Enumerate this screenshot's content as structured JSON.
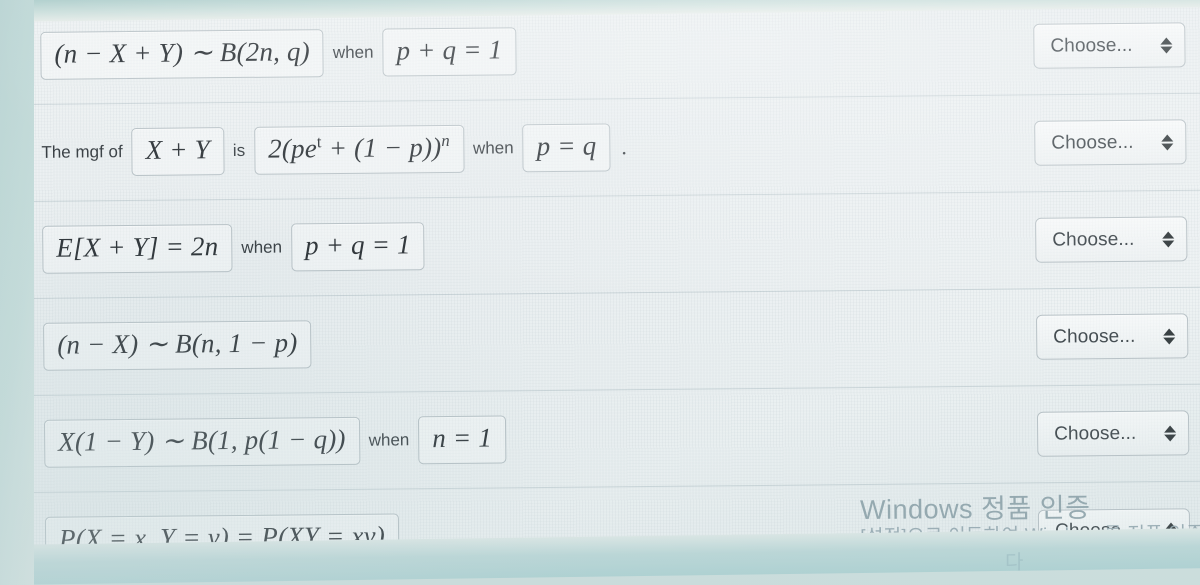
{
  "watermark": {
    "line1": "Windows 정품 인증",
    "line2": "[설정]으로 이동하여 Windows를 정품 인증",
    "line3": "다"
  },
  "select_default": "Choose...",
  "rows": [
    {
      "id": "row-1",
      "lead": "",
      "box1": "(n − X + Y) ∼ B(2n, q)",
      "mid": "when",
      "box2": "p + q = 1",
      "trail": "",
      "select": "Choose..."
    },
    {
      "id": "row-2",
      "lead": "The mgf of",
      "box1": "X + Y",
      "mid": "is",
      "box2": "2(pe",
      "box2_exp": "t",
      "box2_tail": " + (1 − p))",
      "box2_exp2": "n",
      "mid2": "when",
      "box3": "p = q",
      "trail": ".",
      "select": "Choose..."
    },
    {
      "id": "row-3",
      "lead": "",
      "box1": "E[X + Y] = 2n",
      "mid": "when",
      "box2": "p + q = 1",
      "trail": "",
      "select": "Choose..."
    },
    {
      "id": "row-4",
      "lead": "",
      "box1": "(n − X) ∼ B(n, 1 − p)",
      "mid": "",
      "box2": "",
      "trail": "",
      "select": "Choose..."
    },
    {
      "id": "row-5",
      "lead": "",
      "box1": "X(1 − Y) ∼ B(1, p(1 − q))",
      "mid": "when",
      "box2": "n = 1",
      "trail": "",
      "select": "Choose..."
    },
    {
      "id": "row-6",
      "lead": "",
      "box1": "P(X = x, Y = y) = P(XY = xy)",
      "mid": "",
      "box2": "",
      "trail": "",
      "select": "Choose..."
    }
  ]
}
